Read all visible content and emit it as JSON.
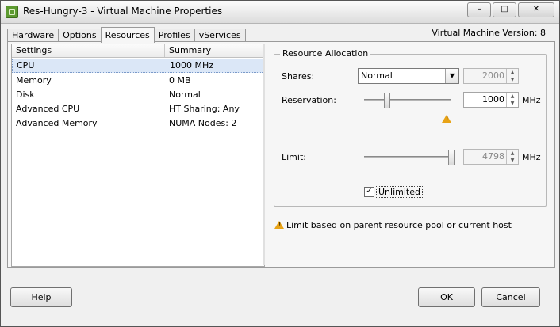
{
  "window": {
    "title": "Res-Hungry-3 - Virtual Machine Properties",
    "buttons": {
      "minimize": "–",
      "maximize": "□",
      "close": "✕"
    }
  },
  "tabs": [
    {
      "label": "Hardware"
    },
    {
      "label": "Options"
    },
    {
      "label": "Resources"
    },
    {
      "label": "Profiles"
    },
    {
      "label": "vServices"
    }
  ],
  "vm_version": "Virtual Machine Version: 8",
  "settings_list": {
    "headers": [
      "Settings",
      "Summary"
    ],
    "rows": [
      {
        "setting": "CPU",
        "summary": "1000 MHz"
      },
      {
        "setting": "Memory",
        "summary": "0 MB"
      },
      {
        "setting": "Disk",
        "summary": "Normal"
      },
      {
        "setting": "Advanced CPU",
        "summary": "HT Sharing: Any"
      },
      {
        "setting": "Advanced Memory",
        "summary": "NUMA Nodes: 2"
      }
    ]
  },
  "resource_allocation": {
    "legend": "Resource Allocation",
    "shares_label": "Shares:",
    "shares_value": "Normal",
    "shares_number": "2000",
    "reservation_label": "Reservation:",
    "reservation_value": "1000",
    "reservation_unit": "MHz",
    "limit_label": "Limit:",
    "limit_value": "4798",
    "limit_unit": "MHz",
    "unlimited_label": "Unlimited",
    "unlimited_checked": "✓"
  },
  "warning_note": "Limit based on parent resource pool or current host",
  "footer": {
    "help": "Help",
    "ok": "OK",
    "cancel": "Cancel"
  }
}
